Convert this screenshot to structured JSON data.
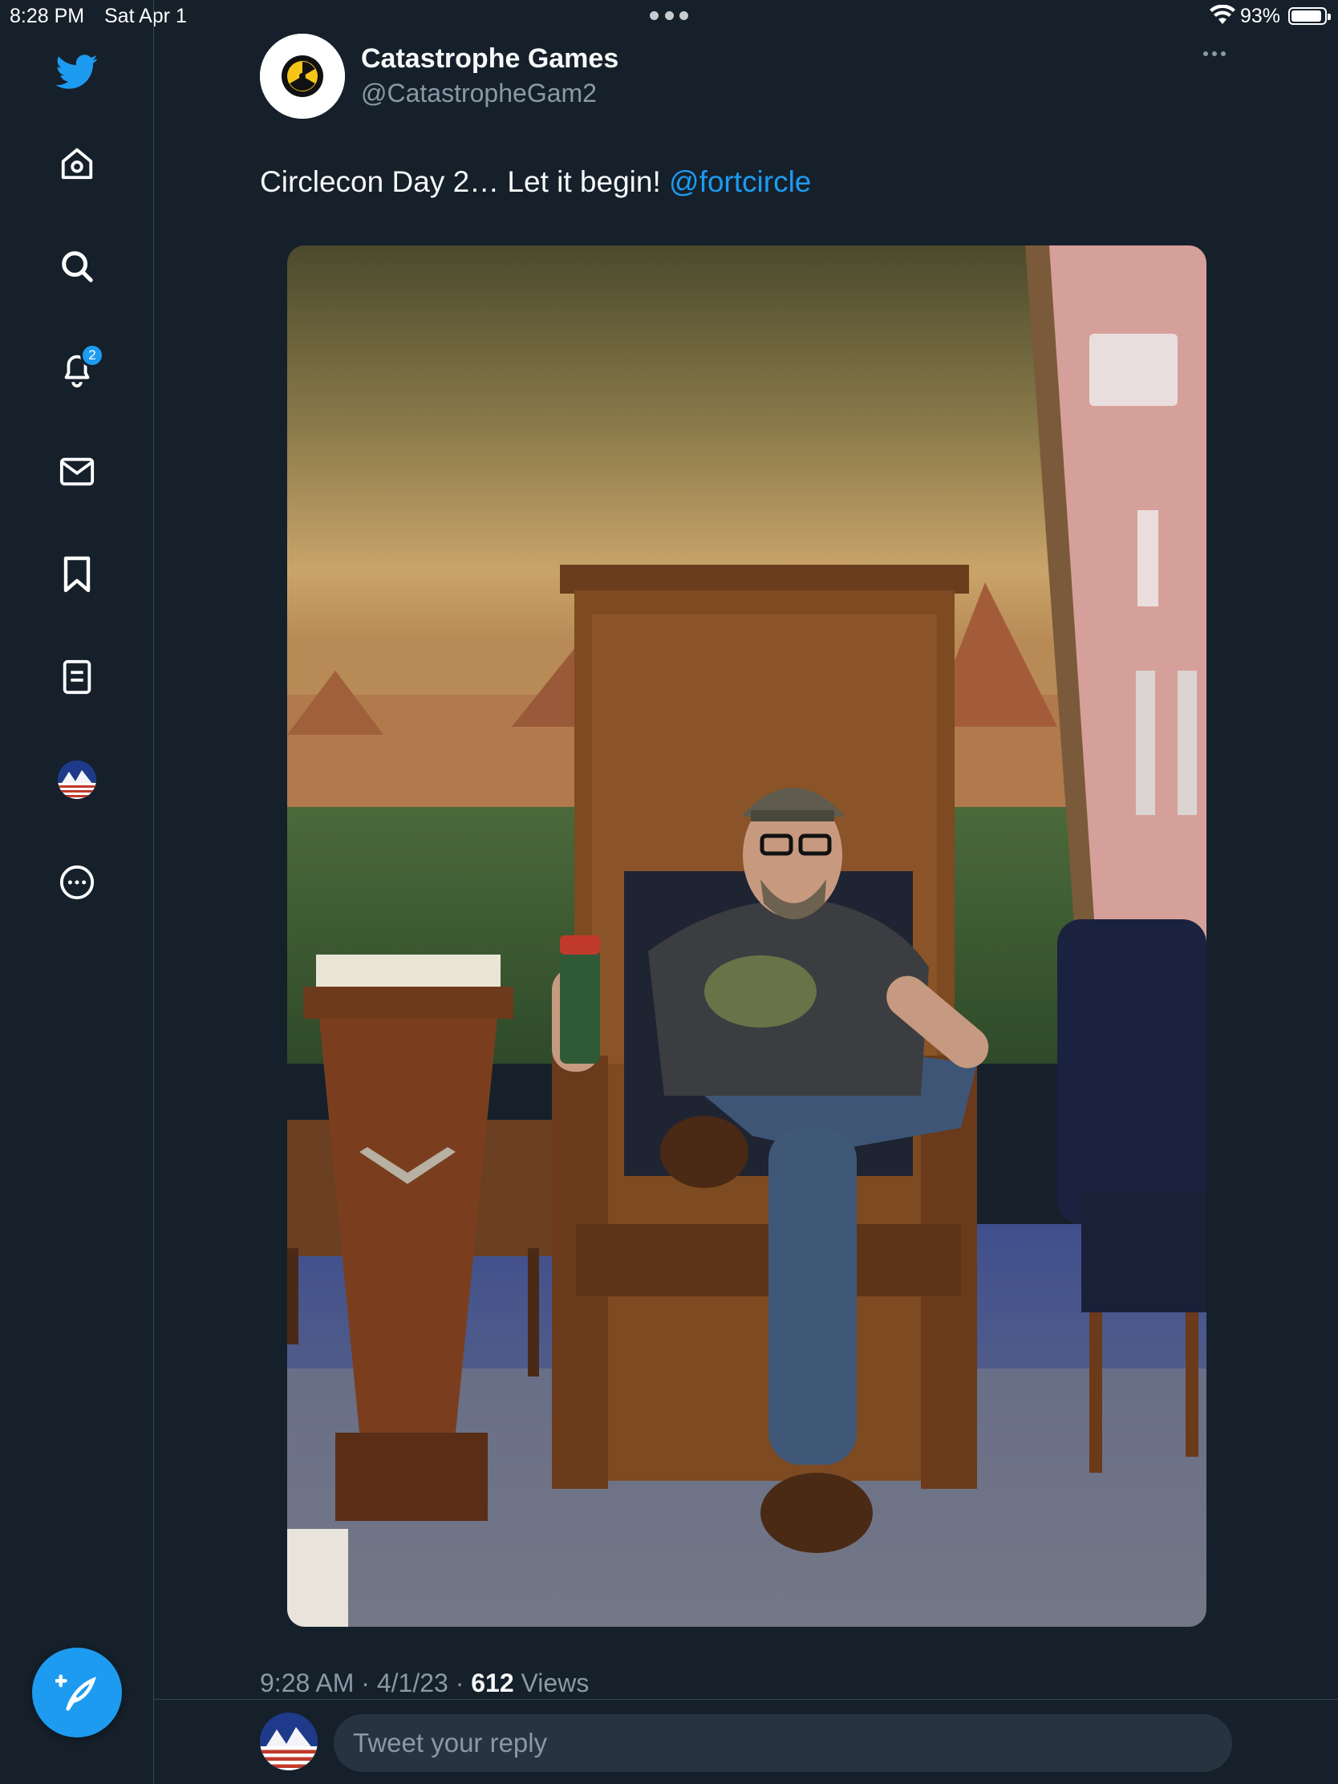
{
  "status_bar": {
    "time": "8:28 PM",
    "date": "Sat Apr 1",
    "battery_percent": "93%",
    "battery_level": 0.93
  },
  "sidebar": {
    "items": [
      {
        "icon": "twitter-bird-icon",
        "label": "Twitter"
      },
      {
        "icon": "home-icon",
        "label": "Home"
      },
      {
        "icon": "search-icon",
        "label": "Explore"
      },
      {
        "icon": "bell-icon",
        "label": "Notifications",
        "badge": "2"
      },
      {
        "icon": "envelope-icon",
        "label": "Messages"
      },
      {
        "icon": "bookmark-icon",
        "label": "Bookmarks"
      },
      {
        "icon": "list-icon",
        "label": "Lists"
      },
      {
        "icon": "profile-avatar-icon",
        "label": "Profile"
      },
      {
        "icon": "more-circle-icon",
        "label": "More"
      }
    ],
    "compose_icon": "compose-feather-icon"
  },
  "tweet": {
    "author_name": "Catastrophe Games",
    "author_handle": "@CatastropheGam2",
    "text": "Circlecon Day 2… Let it begin! ",
    "mention": "@fortcircle",
    "time": "9:28 AM",
    "separator": " · ",
    "date": "4/1/23",
    "views_count": "612",
    "views_label": " Views"
  },
  "reply": {
    "placeholder": "Tweet your reply"
  },
  "colors": {
    "background": "#15202b",
    "accent": "#1d9bf0",
    "secondary_text": "#8b98a5",
    "border": "#38444d"
  }
}
